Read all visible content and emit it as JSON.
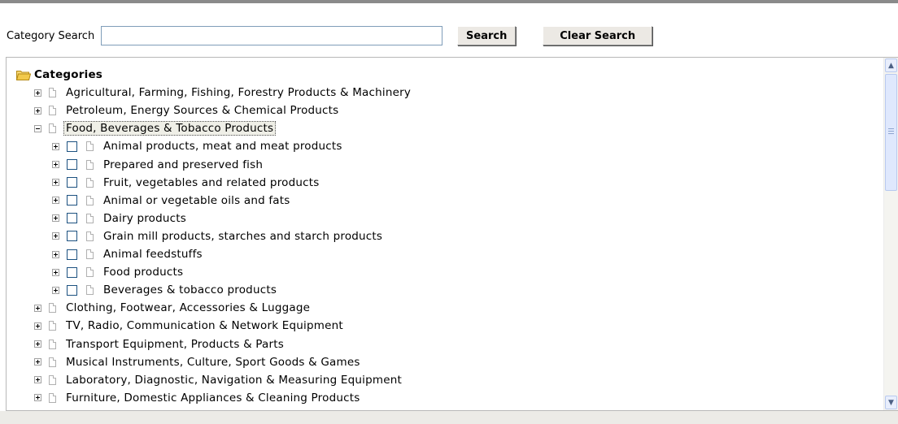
{
  "search": {
    "label": "Category Search",
    "input_value": "",
    "search_button": "Search",
    "clear_button": "Clear Search"
  },
  "tree": {
    "root_label": "Categories",
    "level1_top": [
      {
        "label": "Agricultural, Farming, Fishing, Forestry Products & Machinery",
        "expanded": false
      },
      {
        "label": "Petroleum, Energy Sources & Chemical Products",
        "expanded": false
      },
      {
        "label": "Food, Beverages & Tobacco Products",
        "expanded": true,
        "selected": true
      }
    ],
    "food_children": [
      {
        "label": "Animal products, meat and meat products",
        "checked": false
      },
      {
        "label": "Prepared and preserved fish",
        "checked": false
      },
      {
        "label": "Fruit, vegetables and related products",
        "checked": false
      },
      {
        "label": "Animal or vegetable oils and fats",
        "checked": false
      },
      {
        "label": "Dairy products",
        "checked": false
      },
      {
        "label": "Grain mill products, starches and starch products",
        "checked": false
      },
      {
        "label": "Animal feedstuffs",
        "checked": false
      },
      {
        "label": "Food products",
        "checked": false
      },
      {
        "label": "Beverages & tobacco products",
        "checked": false
      }
    ],
    "level1_bottom": [
      {
        "label": "Clothing, Footwear, Accessories & Luggage",
        "expanded": false
      },
      {
        "label": "TV, Radio, Communication & Network Equipment",
        "expanded": false
      },
      {
        "label": "Transport Equipment, Products & Parts",
        "expanded": false
      },
      {
        "label": "Musical Instruments, Culture, Sport Goods & Games",
        "expanded": false
      },
      {
        "label": "Laboratory, Diagnostic, Navigation & Measuring Equipment",
        "expanded": false
      },
      {
        "label": "Furniture, Domestic Appliances & Cleaning Products",
        "expanded": false
      }
    ]
  },
  "colors": {
    "folder": "#f2c94c",
    "checkbox_border": "#1c5180",
    "scrollbar": "#dfe8fd"
  }
}
